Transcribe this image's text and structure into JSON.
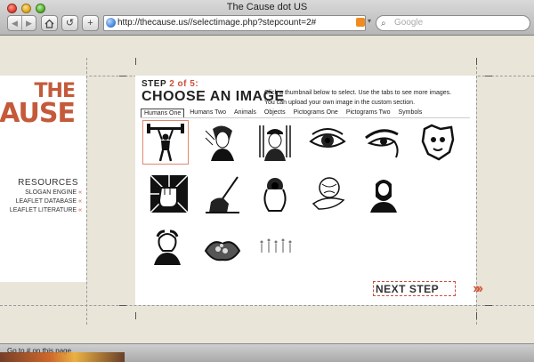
{
  "window": {
    "title": "The Cause dot US"
  },
  "toolbar": {
    "back_icon": "back-arrow-icon",
    "forward_icon": "forward-arrow-icon",
    "home_icon": "home-icon",
    "reload_icon": "reload-icon",
    "add_icon": "plus-icon",
    "url": "http://thecause.us//selectimage.php?stepcount=2#",
    "search_placeholder": "Google"
  },
  "sidebar": {
    "logo_line1": "THE",
    "logo_line2": "CAUSE",
    "resources_title": "RESOURCES",
    "links": [
      "SLOGAN ENGINE",
      "LEAFLET DATABASE",
      "LEAFLET LITERATURE"
    ],
    "link_marker": "«"
  },
  "main": {
    "step_prefix": "STEP ",
    "step_count": "2 of 5",
    "step_suffix": ":",
    "heading": "CHOOSE AN IMAGE",
    "instructions_line1": "Click a thumbnail below to select. Use the tabs to see more images.",
    "instructions_line2": "You can upload your own image in the custom section.",
    "tabs": [
      {
        "label": "Humans One",
        "active": true
      },
      {
        "label": "Humans Two",
        "active": false
      },
      {
        "label": "Animals",
        "active": false
      },
      {
        "label": "Objects",
        "active": false
      },
      {
        "label": "Pictograms One",
        "active": false
      },
      {
        "label": "Pictograms Two",
        "active": false
      },
      {
        "label": "Symbols",
        "active": false
      }
    ],
    "thumbnails": [
      {
        "name": "weightlifter",
        "selected": true
      },
      {
        "name": "woman-portrait"
      },
      {
        "name": "soldier-portrait"
      },
      {
        "name": "eye"
      },
      {
        "name": "eye-profile"
      },
      {
        "name": "face-breaking-through"
      },
      {
        "name": "fist"
      },
      {
        "name": "hand-signing"
      },
      {
        "name": "pointing-gun"
      },
      {
        "name": "hand-holding-globe"
      },
      {
        "name": "lincoln-portrait"
      },
      {
        "name": "washington-portrait"
      },
      {
        "name": "cupped-hands"
      },
      {
        "name": "tiny-figures"
      }
    ],
    "next_label": "NEXT STEP",
    "next_chevrons": "»»"
  },
  "status": {
    "text": "Go to # on this page"
  },
  "colors": {
    "accent": "#c9503a",
    "logo": "#c45a3a"
  }
}
